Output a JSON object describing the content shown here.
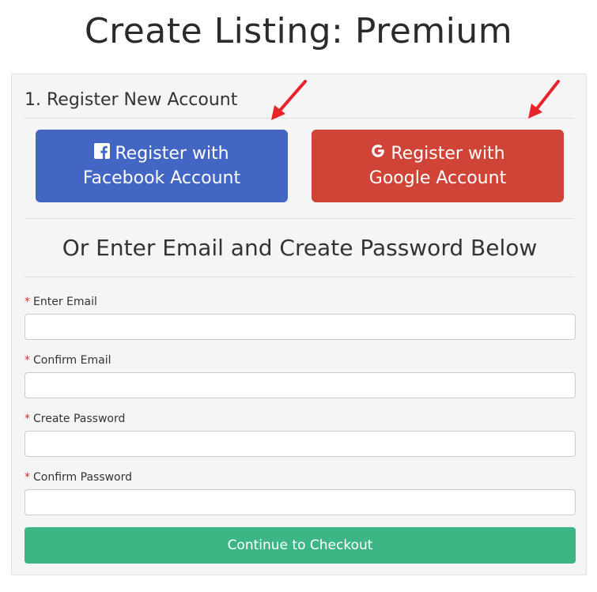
{
  "page": {
    "title": "Create Listing: Premium"
  },
  "register": {
    "heading": "1. Register New Account",
    "facebook_line1": "Register with",
    "facebook_line2": "Facebook Account",
    "facebook_icon": "facebook-icon",
    "google_line1": "Register with",
    "google_line2": "Google Account",
    "google_icon": "google-icon",
    "or_heading": "Or Enter Email and Create Password Below"
  },
  "form": {
    "required_marker": "*",
    "fields": [
      {
        "label": "Enter Email",
        "value": "",
        "placeholder": ""
      },
      {
        "label": "Confirm Email",
        "value": "",
        "placeholder": ""
      },
      {
        "label": "Create Password",
        "value": "",
        "placeholder": ""
      },
      {
        "label": "Confirm Password",
        "value": "",
        "placeholder": ""
      }
    ],
    "submit_label": "Continue to Checkout"
  },
  "colors": {
    "facebook": "#4366c4",
    "google": "#cf4436",
    "submit": "#3db685",
    "annotation_arrow": "#e8232a"
  }
}
